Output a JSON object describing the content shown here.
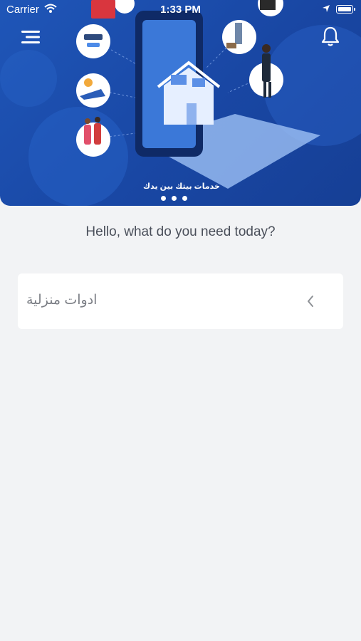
{
  "status_bar": {
    "carrier": "Carrier",
    "time": "1:33 PM",
    "icons": [
      "wifi-icon",
      "location-arrow-icon",
      "battery-icon"
    ]
  },
  "header": {
    "menu_icon": "hamburger-menu-icon",
    "notification_icon": "bell-icon"
  },
  "banner": {
    "slogan": "خدمات بيتك بين يدك",
    "page_count": 3,
    "active_page": 1,
    "colors": {
      "background": "#1f56b8",
      "accent": "#dbe6fb"
    }
  },
  "main": {
    "greeting": "Hello, what do you need today?",
    "categories": [
      {
        "label": "ادوات منزلية",
        "icon": "chevron-left-icon"
      }
    ]
  }
}
